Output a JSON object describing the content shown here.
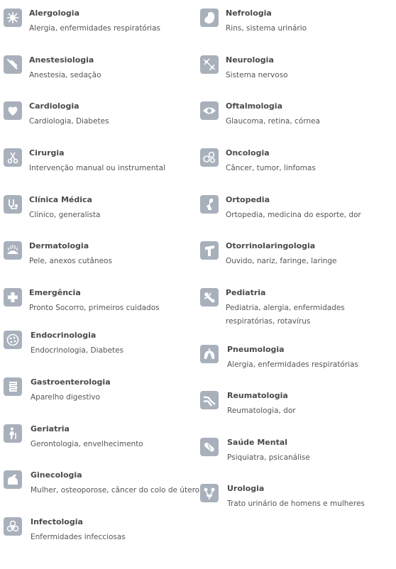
{
  "left": [
    {
      "title": "Alergologia",
      "desc": "Alergia, enfermidades respiratórias",
      "icon": "allergy-icon"
    },
    {
      "title": "Anestesiologia",
      "desc": "Anestesia, sedação",
      "icon": "syringe-icon"
    },
    {
      "title": "Cardiologia",
      "desc": "Cardiologia, Diabetes",
      "icon": "heart-icon"
    },
    {
      "title": "Cirurgia",
      "desc": "Intervenção manual ou instrumental",
      "icon": "scissors-icon"
    },
    {
      "title": "Clínica Médica",
      "desc": "Clínico, generalista",
      "icon": "stethoscope-icon"
    },
    {
      "title": "Dermatologia",
      "desc": "Pele, anexos cutâneos",
      "icon": "skin-icon"
    },
    {
      "title": "Emergência",
      "desc": "Pronto Socorro, primeiros cuidados",
      "icon": "cross-icon"
    },
    {
      "title": "Endocrinologia",
      "desc": "Endocrinologia, Diabetes",
      "icon": "cell-icon"
    },
    {
      "title": "Gastroenterologia",
      "desc": "Aparelho digestivo",
      "icon": "intestine-icon"
    },
    {
      "title": "Geriatria",
      "desc": "Gerontologia, envelhecimento",
      "icon": "elderly-icon"
    },
    {
      "title": "Ginecologia",
      "desc": "Mulher, osteoporose, câncer do colo de útero",
      "icon": "woman-icon"
    },
    {
      "title": "Infectologia",
      "desc": "Enfermidades infecciosas",
      "icon": "biohazard-icon"
    }
  ],
  "right": [
    {
      "title": "Nefrologia",
      "desc": "Rins, sistema urinário",
      "icon": "kidney-icon"
    },
    {
      "title": "Neurologia",
      "desc": "Sistema nervoso",
      "icon": "neuron-icon"
    },
    {
      "title": "Oftalmologia",
      "desc": "Glaucoma, retina, córnea",
      "icon": "eye-icon"
    },
    {
      "title": "Oncologia",
      "desc": "Câncer, tumor, linfomas",
      "icon": "cells-icon"
    },
    {
      "title": "Ortopedia",
      "desc": "Ortopedia, medicina do esporte, dor",
      "icon": "bone-icon"
    },
    {
      "title": "Otorrinolaringologia",
      "desc": "Ouvido, nariz, faringe, laringe",
      "icon": "ent-icon"
    },
    {
      "title": "Pediatria",
      "desc": "Pediatria, alergia, enfermidades respiratórias, rotavírus",
      "icon": "child-icon"
    },
    {
      "title": "Pneumologia",
      "desc": "Alergia, enfermidades respiratórias",
      "icon": "lungs-icon"
    },
    {
      "title": "Reumatologia",
      "desc": "Reumatologia, dor",
      "icon": "joint-icon"
    },
    {
      "title": "Saúde Mental",
      "desc": "Psiquiatra, psicanálise",
      "icon": "pill-icon"
    },
    {
      "title": "Urologia",
      "desc": "Trato urinário de homens e mulheres",
      "icon": "bladder-icon"
    }
  ]
}
